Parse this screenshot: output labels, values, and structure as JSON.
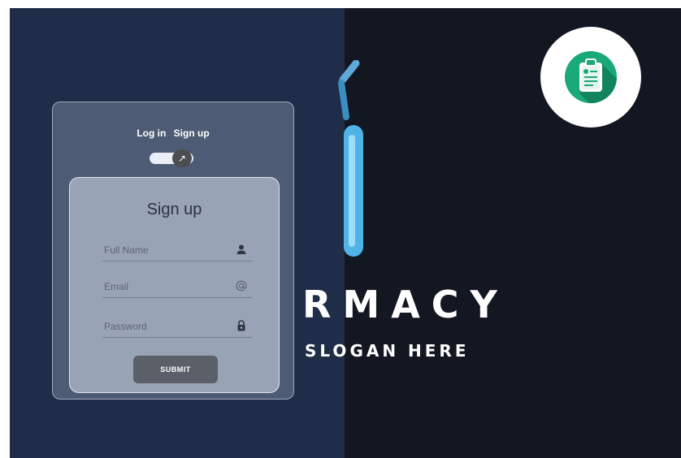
{
  "brand": {
    "name_fragment": "RMACY",
    "slogan_fragment": "SLOGAN HERE"
  },
  "auth": {
    "tabs": {
      "login": "Log in",
      "signup": "Sign up"
    },
    "toggle": {
      "state": "sign-up",
      "knob_icon": "↗"
    },
    "form": {
      "title": "Sign up",
      "full_name_placeholder": "Full Name",
      "email_placeholder": "Email",
      "password_placeholder": "Password",
      "submit_label": "SUBMIT"
    }
  },
  "icons": [
    "user-icon",
    "at-icon",
    "lock-icon",
    "arrow-icon",
    "clipboard-icon"
  ],
  "colors": {
    "left_bg": "#1f2d48",
    "right_bg": "#131722",
    "accent_blue": "#4fb3e6",
    "badge_green": "#1aa97a",
    "submit_bg": "#5a5f68"
  }
}
